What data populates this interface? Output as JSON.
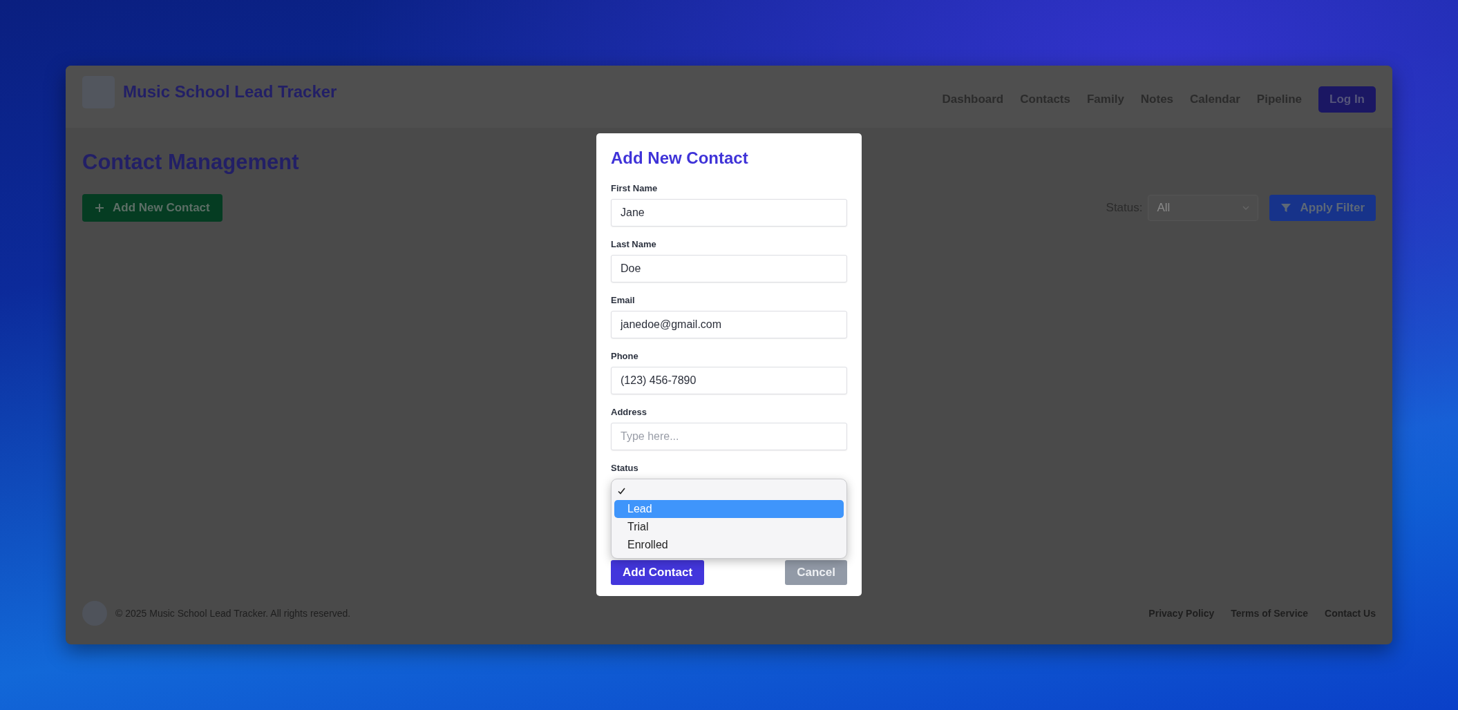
{
  "header": {
    "title": "Music School Lead Tracker",
    "nav": [
      "Dashboard",
      "Contacts",
      "Family",
      "Notes",
      "Calendar",
      "Pipeline"
    ],
    "login_button": "Log In"
  },
  "page": {
    "heading": "Contact Management",
    "add_button": "Add New Contact",
    "filter_label": "Status:",
    "filter_value": "All",
    "apply_button": "Apply Filter"
  },
  "modal": {
    "title": "Add New Contact",
    "fields": [
      {
        "label": "First Name",
        "value": "Jane"
      },
      {
        "label": "Last Name",
        "value": "Doe"
      },
      {
        "label": "Email",
        "value": "janedoe@gmail.com"
      },
      {
        "label": "Phone",
        "value": "(123) 456-7890"
      },
      {
        "label": "Address",
        "placeholder": "Type here..."
      }
    ],
    "status_label": "Status",
    "status_options": [
      {
        "checked": true,
        "highlighted": false
      },
      {
        "label": "Lead",
        "checked": false,
        "highlighted": true
      },
      {
        "label": "Trial",
        "checked": false,
        "highlighted": false
      },
      {
        "label": "Enrolled",
        "checked": false,
        "highlighted": false
      }
    ],
    "submit_button": "Add Contact",
    "cancel_button": "Cancel"
  },
  "footer": {
    "copyright": "© 2025 Music School Lead Tracker. All rights reserved.",
    "links": [
      "Privacy Policy",
      "Terms of Service",
      "Contact Us"
    ]
  }
}
